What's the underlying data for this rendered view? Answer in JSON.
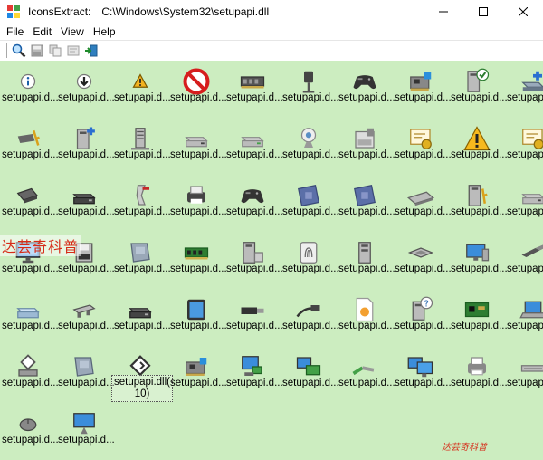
{
  "window": {
    "app_name": "IconsExtract:",
    "file_path": "C:\\Windows\\System32\\setupapi.dll",
    "controls": [
      "minimize",
      "maximize",
      "close"
    ]
  },
  "menu": [
    "File",
    "Edit",
    "View",
    "Help"
  ],
  "toolbar": [
    "search-icon",
    "save-icon",
    "copy-icon",
    "properties-icon",
    "exit-icon"
  ],
  "icons": [
    {
      "label": "setupapi.d...",
      "icon": "info"
    },
    {
      "label": "setupapi.d...",
      "icon": "download"
    },
    {
      "label": "setupapi.d...",
      "icon": "warning-small"
    },
    {
      "label": "setupapi.d...",
      "icon": "prohibited"
    },
    {
      "label": "setupapi.d...",
      "icon": "memory"
    },
    {
      "label": "setupapi.d...",
      "icon": "barcode"
    },
    {
      "label": "setupapi.d...",
      "icon": "gamepad"
    },
    {
      "label": "setupapi.d...",
      "icon": "network-card"
    },
    {
      "label": "setupapi.d...",
      "icon": "computer-check"
    },
    {
      "label": "setupapi.d...",
      "icon": "drive-plus"
    },
    {
      "label": "setupapi.d...",
      "icon": "card-key"
    },
    {
      "label": "setupapi.d...",
      "icon": "computer-plus"
    },
    {
      "label": "setupapi.d...",
      "icon": "server"
    },
    {
      "label": "setupapi.d...",
      "icon": "drive"
    },
    {
      "label": "setupapi.d...",
      "icon": "drive-green"
    },
    {
      "label": "setupapi.d...",
      "icon": "webcam"
    },
    {
      "label": "setupapi.d...",
      "icon": "floppy"
    },
    {
      "label": "setupapi.d...",
      "icon": "certificate"
    },
    {
      "label": "setupapi.d...",
      "icon": "warning"
    },
    {
      "label": "setupapi.d...",
      "icon": "certificate"
    },
    {
      "label": "setupapi.d...",
      "icon": "reader"
    },
    {
      "label": "setupapi.d...",
      "icon": "drive-dark"
    },
    {
      "label": "setupapi.d...",
      "icon": "scanner"
    },
    {
      "label": "setupapi.d...",
      "icon": "printer-dark"
    },
    {
      "label": "setupapi.d...",
      "icon": "gamepad"
    },
    {
      "label": "setupapi.d...",
      "icon": "chip-board"
    },
    {
      "label": "setupapi.d...",
      "icon": "chip-board"
    },
    {
      "label": "setupapi.d...",
      "icon": "keyboard"
    },
    {
      "label": "setupapi.d...",
      "icon": "computer-key"
    },
    {
      "label": "setupapi.d...",
      "icon": "drive"
    },
    {
      "label": "setupapi.d...",
      "icon": "monitor"
    },
    {
      "label": "setupapi.d...",
      "icon": "drive-floppy"
    },
    {
      "label": "setupapi.d...",
      "icon": "expansion-card"
    },
    {
      "label": "setupapi.d...",
      "icon": "memory-green"
    },
    {
      "label": "setupapi.d...",
      "icon": "computer-disk"
    },
    {
      "label": "setupapi.d...",
      "icon": "fingerprint"
    },
    {
      "label": "setupapi.d...",
      "icon": "tower"
    },
    {
      "label": "setupapi.d...",
      "icon": "processor"
    },
    {
      "label": "setupapi.d...",
      "icon": "monitor-blue"
    },
    {
      "label": "setupapi.d...",
      "icon": "usb-plug"
    },
    {
      "label": "setupapi.d...",
      "icon": "drive-blue"
    },
    {
      "label": "setupapi.d...",
      "icon": "network-adapter"
    },
    {
      "label": "setupapi.d...",
      "icon": "drive-dark"
    },
    {
      "label": "setupapi.d...",
      "icon": "tablet"
    },
    {
      "label": "setupapi.d...",
      "icon": "usb-dark"
    },
    {
      "label": "setupapi.d...",
      "icon": "usb-cable"
    },
    {
      "label": "setupapi.d...",
      "icon": "document"
    },
    {
      "label": "setupapi.d...",
      "icon": "computer-question"
    },
    {
      "label": "setupapi.d...",
      "icon": "circuit-board"
    },
    {
      "label": "setupapi.d...",
      "icon": "laptop"
    },
    {
      "label": "setupapi.d...",
      "icon": "network-node"
    },
    {
      "label": "setupapi.d...",
      "icon": "expansion-card"
    },
    {
      "label": "setupapi.dll(​10)",
      "icon": "diamond",
      "selected": true
    },
    {
      "label": "setupapi.d...",
      "icon": "network-card"
    },
    {
      "label": "setupapi.d...",
      "icon": "network-computer"
    },
    {
      "label": "setupapi.d...",
      "icon": "network-computers"
    },
    {
      "label": "setupapi.d...",
      "icon": "network-cable"
    },
    {
      "label": "setupapi.d...",
      "icon": "monitors"
    },
    {
      "label": "setupapi.d...",
      "icon": "printer"
    },
    {
      "label": "setupapi.d...",
      "icon": "keyboard-flat"
    },
    {
      "label": "setupapi.d...",
      "icon": "mouse"
    },
    {
      "label": "setupapi.d...",
      "icon": "monitor-stand"
    }
  ],
  "watermark": {
    "left": "达芸奇科普",
    "bottom_right": "达芸奇科普"
  }
}
